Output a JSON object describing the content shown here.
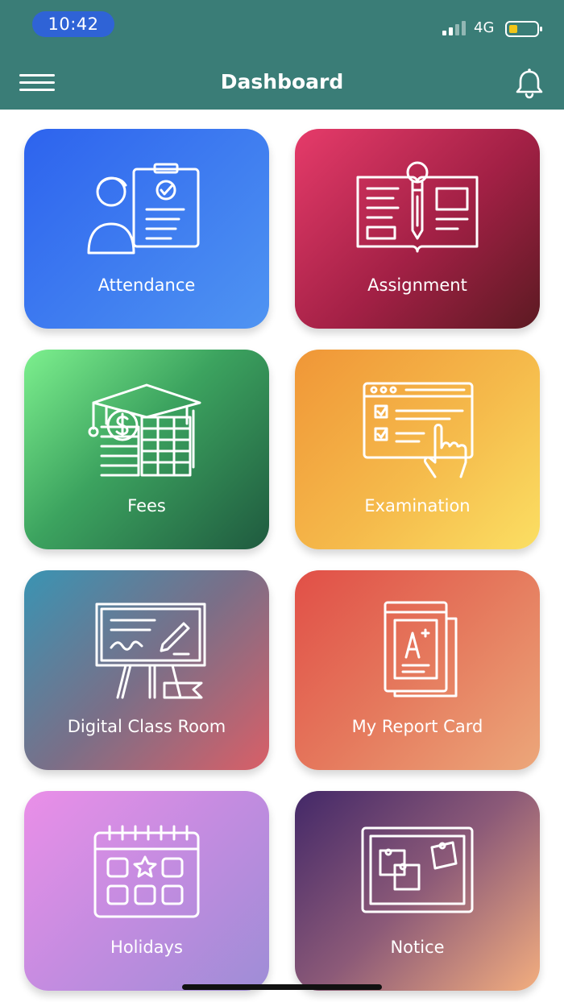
{
  "status_bar": {
    "time": "10:42",
    "network": "4G",
    "icons": [
      "signal-icon",
      "battery-icon"
    ],
    "battery_accent": "#f2c518"
  },
  "app_bar": {
    "title": "Dashboard",
    "menu_icon": "hamburger-menu-icon",
    "notification_icon": "bell-icon",
    "background": "#3a7d77"
  },
  "tiles": [
    {
      "id": "attendance",
      "label": "Attendance",
      "icon": "attendance-icon"
    },
    {
      "id": "assignment",
      "label": "Assignment",
      "icon": "assignment-icon"
    },
    {
      "id": "fees",
      "label": "Fees",
      "icon": "fees-icon"
    },
    {
      "id": "examination",
      "label": "Examination",
      "icon": "examination-icon"
    },
    {
      "id": "digital-class-room",
      "label": "Digital Class Room",
      "icon": "digital-class-room-icon"
    },
    {
      "id": "my-report-card",
      "label": "My Report Card",
      "icon": "report-card-icon"
    },
    {
      "id": "holidays",
      "label": "Holidays",
      "icon": "holidays-calendar-icon"
    },
    {
      "id": "notice",
      "label": "Notice",
      "icon": "notice-board-icon"
    }
  ]
}
